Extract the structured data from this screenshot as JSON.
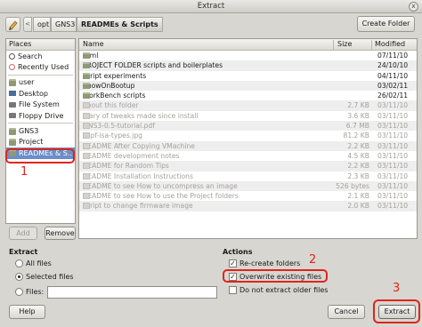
{
  "window": {
    "title": "Extract",
    "close_glyph": "x"
  },
  "toolbar": {
    "path_arrow": "<",
    "breadcrumbs": [
      "opt",
      "GNS3",
      "READMEs & Scripts"
    ],
    "create_folder": "Create Folder"
  },
  "places": {
    "header": "Places",
    "items": [
      {
        "label": "Search",
        "icon": "search-icon"
      },
      {
        "label": "Recently Used",
        "icon": "clock-icon"
      },
      {
        "label": "user",
        "icon": "folder-icon"
      },
      {
        "label": "Desktop",
        "icon": "desktop-icon"
      },
      {
        "label": "File System",
        "icon": "drive-icon"
      },
      {
        "label": "Floppy Drive",
        "icon": "floppy-icon"
      },
      {
        "label": "GNS3",
        "icon": "folder-icon"
      },
      {
        "label": "Project",
        "icon": "folder-icon"
      },
      {
        "label": "READMEs & S…",
        "icon": "folder-icon",
        "selected": true
      }
    ],
    "add_label": "Add",
    "remove_label": "Remove"
  },
  "files": {
    "columns": {
      "name": "Name",
      "size": "Size",
      "modified": "Modified"
    },
    "rows": [
      {
        "name": "html",
        "size": "",
        "modified": "07/11/10",
        "type": "dir"
      },
      {
        "name": "PROJECT FOLDER scripts and boilerplates",
        "size": "",
        "modified": "24/10/10",
        "type": "dir"
      },
      {
        "name": "script experiments",
        "size": "",
        "modified": "04/11/10",
        "type": "dir"
      },
      {
        "name": "ShowOnBootup",
        "size": "",
        "modified": "03/02/11",
        "type": "dir"
      },
      {
        "name": "WorkBench scripts",
        "size": "",
        "modified": "26/02/11",
        "type": "dir"
      },
      {
        "name": "about this folder",
        "size": "2.7 KB",
        "modified": "03/11/10",
        "type": "file"
      },
      {
        "name": "diary of tweaks made since install",
        "size": "3.6 KB",
        "modified": "03/11/10",
        "type": "file"
      },
      {
        "name": "GNS3-0.5-tutorial.pdf",
        "size": "6.7 MB",
        "modified": "03/11/10",
        "type": "file"
      },
      {
        "name": "ospf-isa-types.jpg",
        "size": "81.2 KB",
        "modified": "03/11/10",
        "type": "file"
      },
      {
        "name": "README After Copying VMachine",
        "size": "2.2 KB",
        "modified": "03/11/10",
        "type": "file"
      },
      {
        "name": "README development notes",
        "size": "4.5 KB",
        "modified": "03/11/10",
        "type": "file"
      },
      {
        "name": "README for Random Tips",
        "size": "2.2 KB",
        "modified": "03/11/10",
        "type": "file"
      },
      {
        "name": "README Installation Instructions",
        "size": "2.3 KB",
        "modified": "03/11/10",
        "type": "file"
      },
      {
        "name": "README to see How to uncompress an image",
        "size": "526 bytes",
        "modified": "03/11/10",
        "type": "file"
      },
      {
        "name": "README to see How to use the Project folders",
        "size": "2.1 KB",
        "modified": "03/11/10",
        "type": "file"
      },
      {
        "name": "script to change firmware image",
        "size": "2.0 KB",
        "modified": "03/11/10",
        "type": "file"
      }
    ]
  },
  "extract": {
    "title": "Extract",
    "all_files": "All files",
    "selected_files": "Selected files",
    "files_label": "Files:",
    "files_value": ""
  },
  "actions": {
    "title": "Actions",
    "recreate_folders": "Re-create folders",
    "overwrite": "Overwrite existing files",
    "no_older": "Do not extract older files"
  },
  "buttons": {
    "help": "Help",
    "cancel": "Cancel",
    "extract": "Extract"
  },
  "annotations": [
    "1",
    "2",
    "3"
  ],
  "colors": {
    "annotation_red": "#e0241c",
    "selection_blue": "#6a8ec9"
  }
}
